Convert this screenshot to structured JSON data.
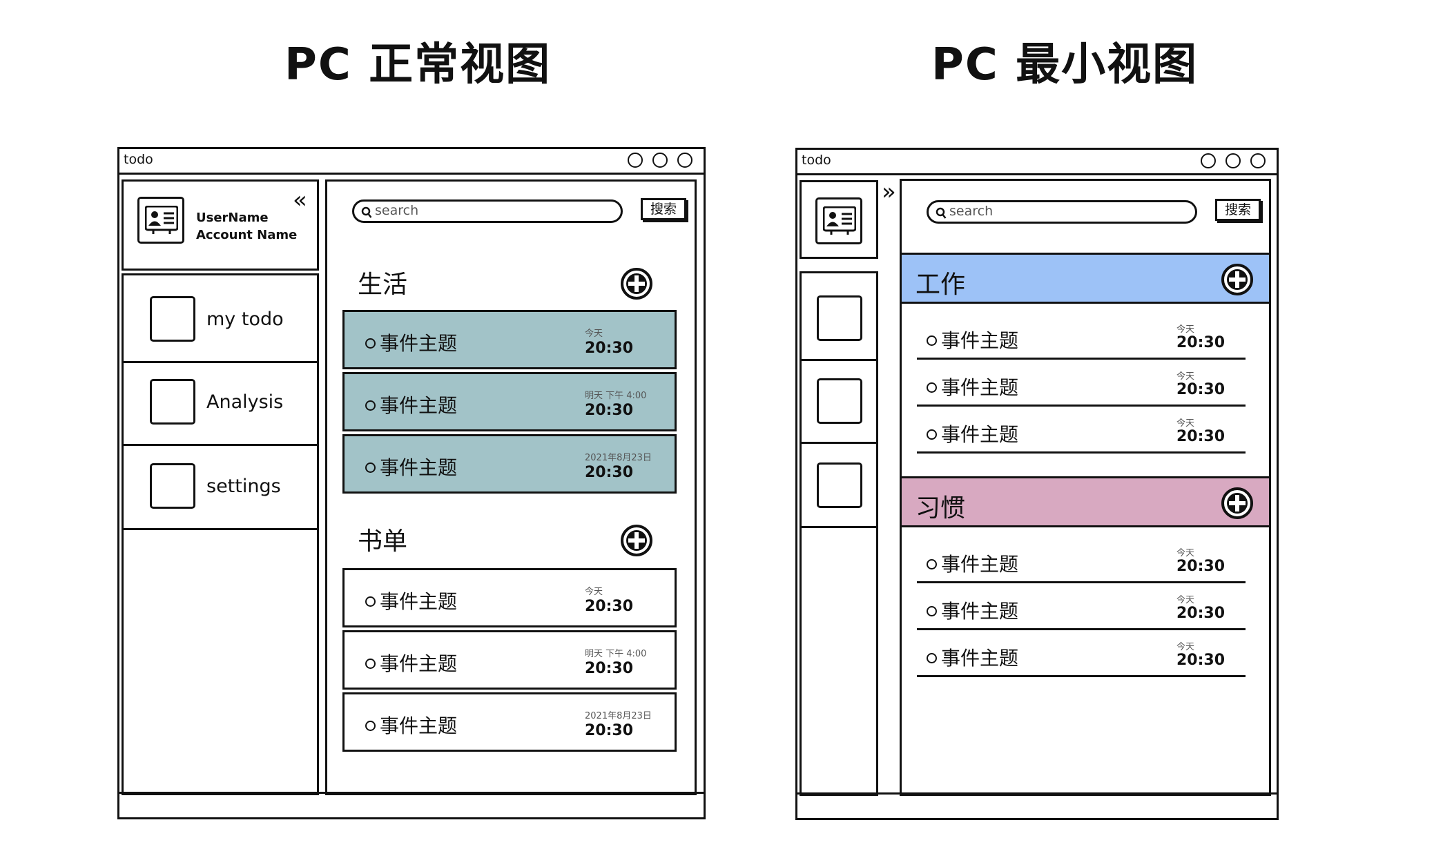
{
  "headings": {
    "normal": "PC 正常视图",
    "minimal": "PC 最小视图"
  },
  "window": {
    "title": "todo"
  },
  "colors": {
    "teal_card": "#a2c3c8",
    "work_band": "#9dc2f7",
    "habit_band": "#d8a9c1"
  },
  "user": {
    "username": "UserName",
    "account": "Account Name",
    "avatar_icon": "contact-card-icon"
  },
  "sidebar": {
    "collapse_icon": "«",
    "expand_icon": "»",
    "items": [
      {
        "label": "my todo"
      },
      {
        "label": "Analysis"
      },
      {
        "label": "settings"
      }
    ]
  },
  "search": {
    "placeholder": "search",
    "button": "搜索"
  },
  "normal_view": {
    "sections": [
      {
        "title": "生活",
        "items": [
          {
            "title": "事件主题",
            "day": "今天",
            "time": "20:30"
          },
          {
            "title": "事件主题",
            "day": "明天 下午 4:00",
            "time": "20:30"
          },
          {
            "title": "事件主题",
            "day": "2021年8月23日",
            "time": "20:30"
          }
        ]
      },
      {
        "title": "书单",
        "items": [
          {
            "title": "事件主题",
            "day": "今天",
            "time": "20:30"
          },
          {
            "title": "事件主题",
            "day": "明天 下午 4:00",
            "time": "20:30"
          },
          {
            "title": "事件主题",
            "day": "2021年8月23日",
            "time": "20:30"
          }
        ]
      }
    ]
  },
  "minimal_view": {
    "sections": [
      {
        "title": "工作",
        "items": [
          {
            "title": "事件主题",
            "day": "今天",
            "time": "20:30"
          },
          {
            "title": "事件主题",
            "day": "今天",
            "time": "20:30"
          },
          {
            "title": "事件主题",
            "day": "今天",
            "time": "20:30"
          }
        ]
      },
      {
        "title": "习惯",
        "items": [
          {
            "title": "事件主题",
            "day": "今天",
            "time": "20:30"
          },
          {
            "title": "事件主题",
            "day": "今天",
            "time": "20:30"
          },
          {
            "title": "事件主题",
            "day": "今天",
            "time": "20:30"
          }
        ]
      }
    ]
  }
}
